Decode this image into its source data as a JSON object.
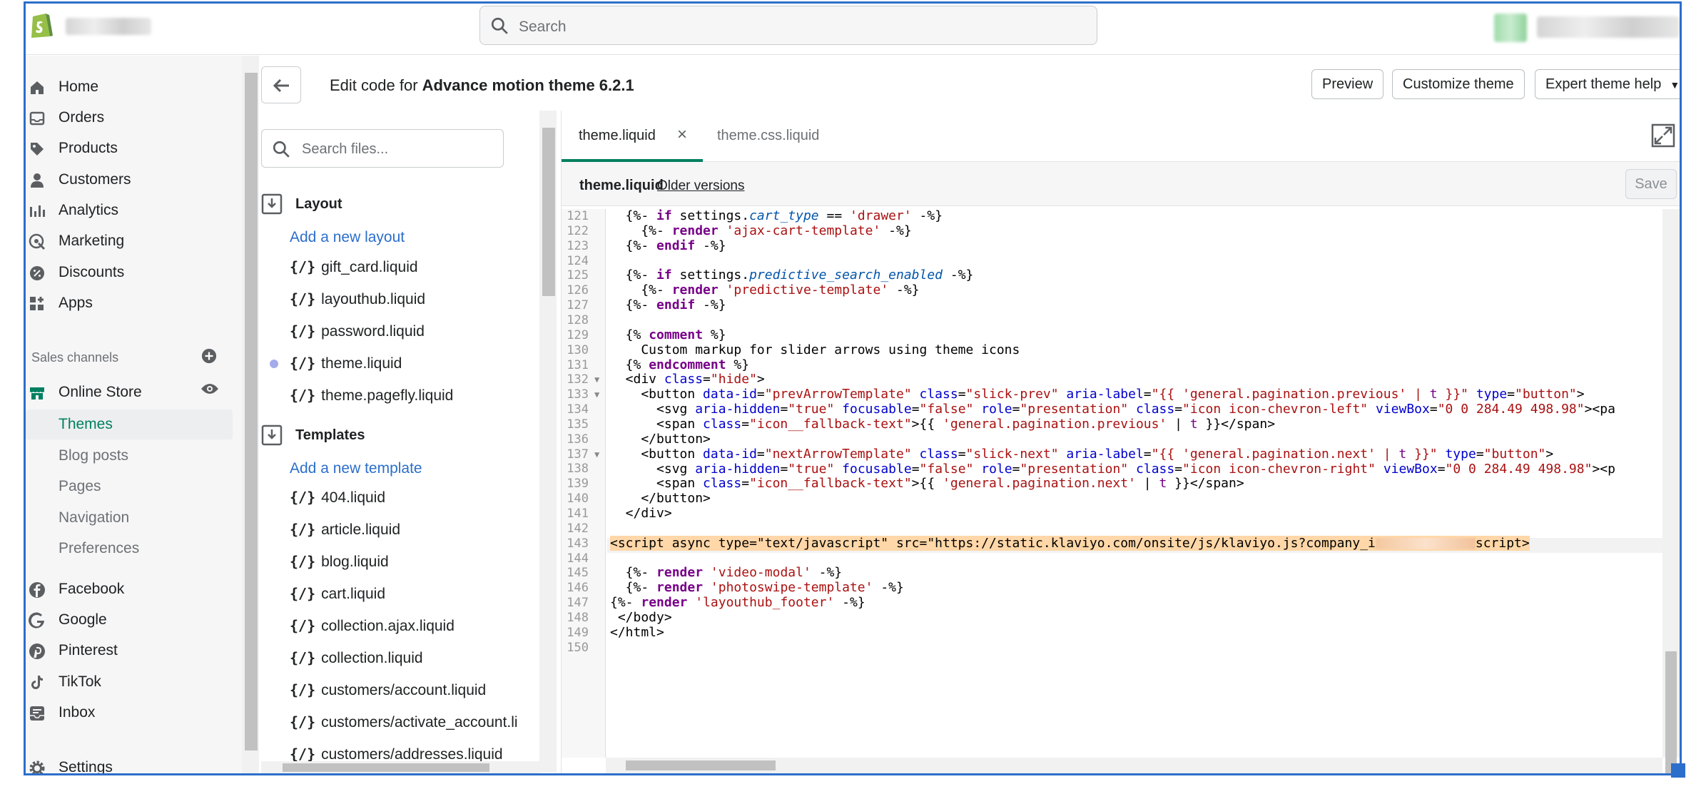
{
  "topbar": {
    "search_placeholder": "Search"
  },
  "sidebar": {
    "items": [
      {
        "label": "Home",
        "icon": "home-icon"
      },
      {
        "label": "Orders",
        "icon": "orders-icon"
      },
      {
        "label": "Products",
        "icon": "tag-icon"
      },
      {
        "label": "Customers",
        "icon": "person-icon"
      },
      {
        "label": "Analytics",
        "icon": "bar-chart-icon"
      },
      {
        "label": "Marketing",
        "icon": "target-icon"
      },
      {
        "label": "Discounts",
        "icon": "discount-icon"
      },
      {
        "label": "Apps",
        "icon": "apps-icon"
      }
    ],
    "sales_channels_label": "Sales channels",
    "online_store": "Online Store",
    "online_store_subitems": [
      "Themes",
      "Blog posts",
      "Pages",
      "Navigation",
      "Preferences"
    ],
    "channels": [
      {
        "label": "Facebook",
        "icon": "facebook-icon"
      },
      {
        "label": "Google",
        "icon": "google-icon"
      },
      {
        "label": "Pinterest",
        "icon": "pinterest-icon"
      },
      {
        "label": "TikTok",
        "icon": "tiktok-icon"
      },
      {
        "label": "Inbox",
        "icon": "inbox-icon"
      }
    ],
    "settings": "Settings"
  },
  "header": {
    "title_prefix": "Edit code for ",
    "theme_name": "Advance motion theme 6.2.1",
    "preview": "Preview",
    "customize": "Customize theme",
    "expert": "Expert theme help"
  },
  "files": {
    "search_placeholder": "Search files...",
    "layout": {
      "title": "Layout",
      "add_link": "Add a new layout",
      "items": [
        "gift_card.liquid",
        "layouthub.liquid",
        "password.liquid",
        "theme.liquid",
        "theme.pagefly.liquid"
      ]
    },
    "templates": {
      "title": "Templates",
      "add_link": "Add a new template",
      "items": [
        "404.liquid",
        "article.liquid",
        "blog.liquid",
        "cart.liquid",
        "collection.ajax.liquid",
        "collection.liquid",
        "customers/account.liquid",
        "customers/activate_account.li",
        "customers/addresses.liquid"
      ]
    },
    "brace": "{/}"
  },
  "editor": {
    "tabs": [
      "theme.liquid",
      "theme.css.liquid"
    ],
    "close": "×",
    "file_name": "theme.liquid",
    "older_versions": "Older versions",
    "save": "Save",
    "line_numbers": [
      "121",
      "122",
      "123",
      "124",
      "125",
      "126",
      "127",
      "128",
      "129",
      "130",
      "131",
      "132",
      "133",
      "134",
      "135",
      "136",
      "137",
      "138",
      "139",
      "140",
      "141",
      "142",
      "143",
      "144",
      "145",
      "146",
      "147",
      "148",
      "149",
      "150"
    ],
    "line_143_start": "<script async type=\"text/javascript\" src=\"https://static.klaviyo.com/onsite/js/klaviyo.js?company_i",
    "line_143_end": "script>"
  }
}
